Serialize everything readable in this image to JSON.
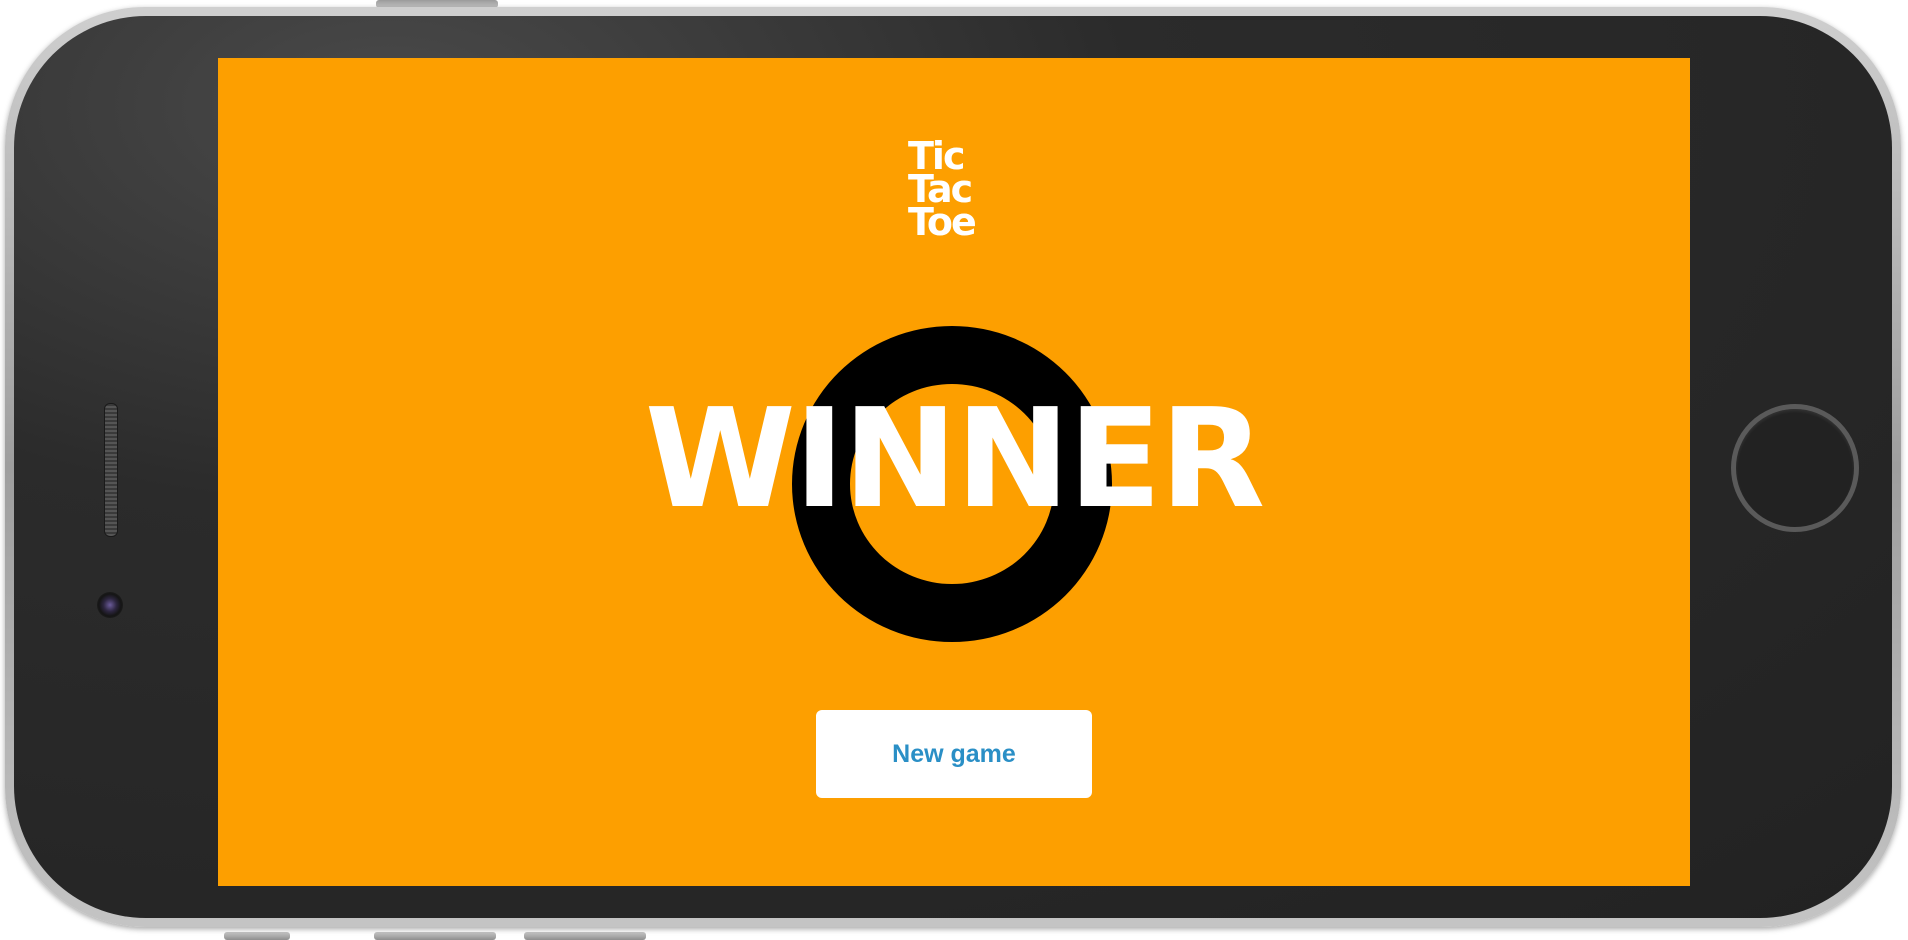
{
  "logo": {
    "lines": [
      "Tic",
      "Tac",
      "Toe"
    ]
  },
  "result": {
    "title": "WINNER",
    "winner_symbol": "O"
  },
  "actions": {
    "new_game_label": "New game"
  },
  "colors": {
    "screen_background": "#fd9f00",
    "symbol": "#000000",
    "text": "#ffffff",
    "button_text": "#2a8fc6"
  },
  "icons": {
    "winner_mark": "circle-o-icon"
  }
}
